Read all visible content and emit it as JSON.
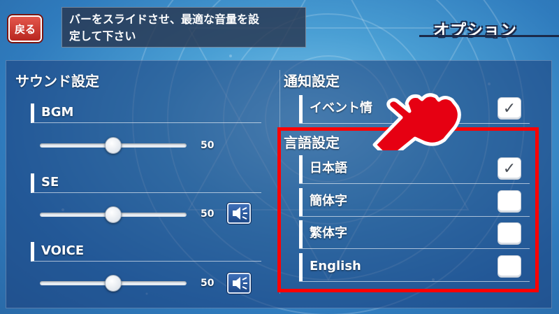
{
  "header": {
    "back_label": "戻る",
    "hint_line1": "バーをスライドさせ、最適な音量を設",
    "hint_line2": "定して下さい",
    "screen_title": "オプション"
  },
  "sound": {
    "title": "サウンド設定",
    "channels": [
      {
        "label": "BGM",
        "value": 50,
        "value_text": "50",
        "max": 100,
        "has_test_button": false
      },
      {
        "label": "SE",
        "value": 50,
        "value_text": "50",
        "max": 100,
        "has_test_button": true
      },
      {
        "label": "VOICE",
        "value": 50,
        "value_text": "50",
        "max": 100,
        "has_test_button": true
      }
    ],
    "test_icon": "speaker-test-icon"
  },
  "notification": {
    "title": "通知設定",
    "items": [
      {
        "label": "イベント情",
        "checked": true
      }
    ]
  },
  "language": {
    "title": "言語設定",
    "items": [
      {
        "label": "日本語",
        "checked": true
      },
      {
        "label": "簡体字",
        "checked": false
      },
      {
        "label": "繁体字",
        "checked": false
      },
      {
        "label": "English",
        "checked": false
      }
    ]
  },
  "colors": {
    "back_button": "#c8322a",
    "highlight": "#ff0000",
    "pointer": "#e60012"
  },
  "icons": {
    "check": "✓",
    "pointer": "pointing-hand-icon"
  }
}
